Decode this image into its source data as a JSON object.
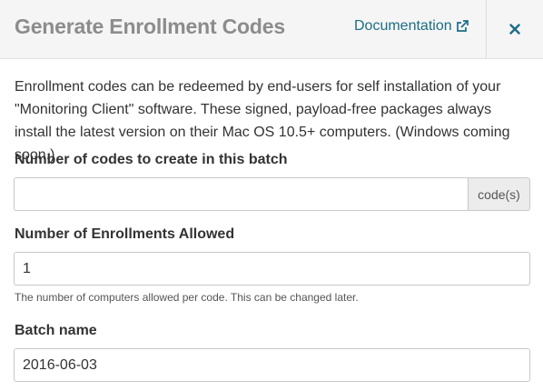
{
  "header": {
    "title": "Generate Enrollment Codes",
    "documentation_label": "Documentation",
    "close_symbol": "×"
  },
  "description": "Enrollment codes can be redeemed by end-users for self installation of your \"Monitoring Client\" software. These signed, payload-free packages always install the latest version on their Mac OS 10.5+ computers. (Windows coming soon.)",
  "form": {
    "codes_count": {
      "label": "Number of codes to create in this batch",
      "value": "",
      "addon": "code(s)"
    },
    "enrollments_allowed": {
      "label": "Number of Enrollments Allowed",
      "value": "1",
      "help": "The number of computers allowed per code. This can be changed later."
    },
    "batch_name": {
      "label": "Batch name",
      "value": "2016-06-03"
    }
  },
  "icons": {
    "external": "external-link-icon",
    "close": "close-icon"
  },
  "colors": {
    "link": "#1b6d85",
    "title": "#8c8c8c",
    "header_bg": "#f5f5f5"
  }
}
